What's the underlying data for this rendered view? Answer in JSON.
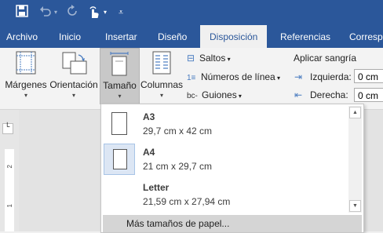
{
  "qat": {
    "save_icon": "save-icon",
    "undo_icon": "undo-icon",
    "redo_icon": "redo-icon",
    "touch_icon": "touch-mode-icon",
    "customize_icon": "customize-qat-icon"
  },
  "tabs": [
    {
      "label": "Archivo",
      "active": false
    },
    {
      "label": "Inicio",
      "active": false
    },
    {
      "label": "Insertar",
      "active": false
    },
    {
      "label": "Diseño",
      "active": false
    },
    {
      "label": "Disposición",
      "active": true
    },
    {
      "label": "Referencias",
      "active": false
    },
    {
      "label": "Corresp",
      "active": false
    }
  ],
  "ribbon": {
    "margenes": "Márgenes",
    "orientacion": "Orientación",
    "tamano": "Tamaño",
    "columnas": "Columnas",
    "saltos": "Saltos",
    "numeros_linea": "Números de línea",
    "guiones": "Guiones",
    "aplicar_sangria": "Aplicar sangría",
    "izquierda": "Izquierda:",
    "derecha": "Derecha:",
    "izquierda_value": "0 cm",
    "derecha_value": "0 cm"
  },
  "ruler": {
    "marks": [
      "2",
      "1"
    ]
  },
  "dropdown": {
    "items": [
      {
        "name": "A3",
        "size": "29,7 cm x 42 cm",
        "selected": false
      },
      {
        "name": "A4",
        "size": "21 cm x 29,7 cm",
        "selected": true
      },
      {
        "name": "Letter",
        "size": "21,59 cm x 27,94 cm",
        "selected": false
      }
    ],
    "more": "Más tamaños de papel..."
  },
  "colors": {
    "accent": "#2b579a",
    "ribbon_bg": "#f3f3f3",
    "selected_item": "#dce6f4"
  }
}
